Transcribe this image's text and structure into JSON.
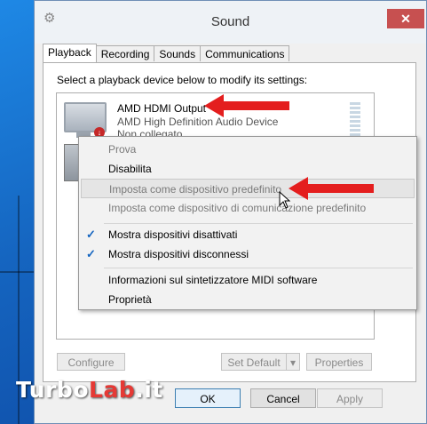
{
  "window": {
    "title": "Sound",
    "close_glyph": "✕"
  },
  "tabs": [
    {
      "label": "Playback",
      "active": true
    },
    {
      "label": "Recording",
      "active": false
    },
    {
      "label": "Sounds",
      "active": false
    },
    {
      "label": "Communications",
      "active": false
    }
  ],
  "panel": {
    "instruction": "Select a playback device below to modify its settings:"
  },
  "device": {
    "name": "AMD HDMI Output",
    "driver": "AMD High Definition Audio Device",
    "status": "Non collegato"
  },
  "context_menu": {
    "items": [
      {
        "label": "Prova",
        "disabled": true,
        "checked": false
      },
      {
        "label": "Disabilita",
        "disabled": false,
        "checked": false
      },
      {
        "label": "Imposta come dispositivo predefinito",
        "disabled": true,
        "checked": false,
        "hover": true
      },
      {
        "label": "Imposta come dispositivo di comunicazione predefinito",
        "disabled": true,
        "checked": false
      },
      {
        "label": "Mostra dispositivi disattivati",
        "disabled": false,
        "checked": true
      },
      {
        "label": "Mostra dispositivi disconnessi",
        "disabled": false,
        "checked": true
      },
      {
        "label": "Informazioni sul sintetizzatore MIDI software",
        "disabled": false,
        "checked": false
      },
      {
        "label": "Proprietà",
        "disabled": false,
        "checked": false
      }
    ],
    "check_glyph": "✓"
  },
  "buttons": {
    "configure": "Configure",
    "set_default": "Set Default",
    "properties": "Properties",
    "ok": "OK",
    "cancel": "Cancel",
    "apply": "Apply"
  },
  "watermark": {
    "part1": "Turbo",
    "part2": "Lab",
    "part3": ".it"
  },
  "colors": {
    "arrow": "#e41e1e",
    "check": "#1565c0",
    "close": "#c75050"
  }
}
